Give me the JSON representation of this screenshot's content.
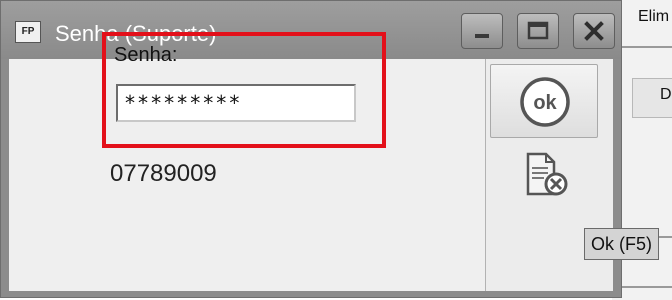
{
  "background_app": {
    "top_label": "Elim",
    "button_label": "D"
  },
  "window": {
    "icon_text": "FP",
    "title": "Senha (Suporte)",
    "controls": [
      "minimize-icon",
      "maximize-icon",
      "close-icon"
    ]
  },
  "form": {
    "password_label": "Senha:",
    "password_value": "*********",
    "code": "07789009"
  },
  "actions": {
    "ok_icon": "ok-icon",
    "cancel_icon": "cancel-document-icon",
    "tooltip": "Ok (F5)"
  },
  "colors": {
    "highlight": "#e3101a",
    "titlebar": "#8c8c8c"
  }
}
